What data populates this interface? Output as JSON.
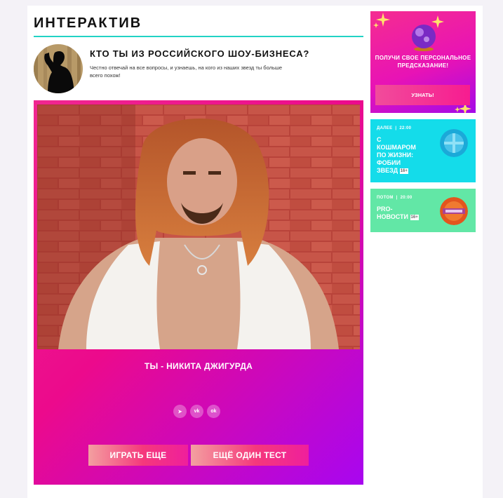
{
  "section": {
    "title": "ИНТЕРАКТИВ"
  },
  "intro": {
    "title": "КТО ТЫ ИЗ РОССИЙСКОГО ШОУ-БИЗНЕСА?",
    "description": "Честно отвечай на все вопросы, и узнаешь, на кого из наших звезд ты больше всего похож!"
  },
  "quiz": {
    "result": "ТЫ - НИКИТА ДЖИГУРДА",
    "share": [
      {
        "icon": "telegram-icon",
        "glyph": "➤"
      },
      {
        "icon": "vk-icon",
        "glyph": "vk"
      },
      {
        "icon": "odnoklassniki-icon",
        "glyph": "ok"
      }
    ],
    "play_again": "ИГРАТЬ ЕЩЕ",
    "another_test": "ЕЩЁ ОДИН ТЕСТ"
  },
  "sidebar": {
    "promo": {
      "text": "ПОЛУЧИ СВОЕ ПЕРСОНАЛЬНОЕ ПРЕДСКАЗАНИЕ!",
      "button": "УЗНАТЬ!"
    },
    "schedule": [
      {
        "label": "ДАЛЕЕ",
        "time": "22:00",
        "title": "С КОШМАРОМ ПО ЖИЗНИ: ФОБИИ ЗВЕЗД",
        "age": "16+"
      },
      {
        "label": "ПОТОМ",
        "time": "20:00",
        "title": "PRO-НОВОСТИ",
        "age": "16+"
      }
    ]
  },
  "colors": {
    "accent_rule": "#22d3c5",
    "pink": "#ec0a8c",
    "purple": "#a806f0",
    "cyan": "#14dcea",
    "mint": "#62e7a6"
  }
}
